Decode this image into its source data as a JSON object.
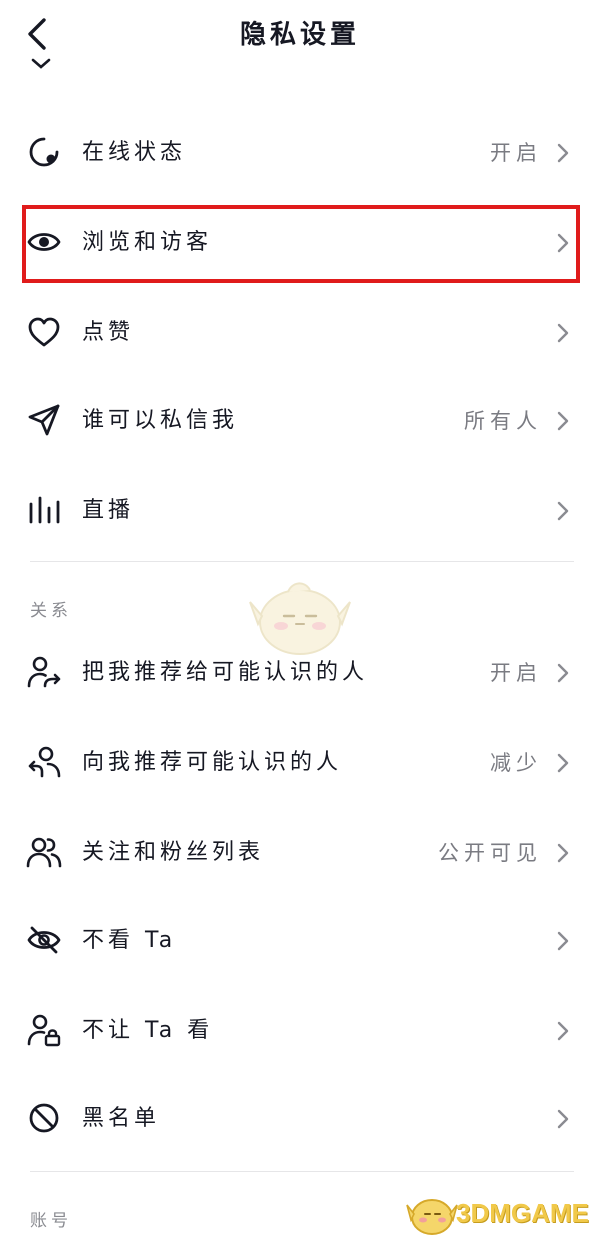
{
  "header": {
    "title": "隐私设置",
    "back_icon": "chevron-left-icon"
  },
  "rows": [
    {
      "icon": "online-status-icon",
      "label": "在线状态",
      "value": "开启"
    },
    {
      "icon": "eye-icon",
      "label": "浏览和访客",
      "value": ""
    },
    {
      "icon": "heart-icon",
      "label": "点赞",
      "value": ""
    },
    {
      "icon": "paper-plane-icon",
      "label": "谁可以私信我",
      "value": "所有人"
    },
    {
      "icon": "live-bars-icon",
      "label": "直播",
      "value": ""
    }
  ],
  "relation": {
    "section_title": "关系",
    "rows": [
      {
        "icon": "user-share-icon",
        "label": "把我推荐给可能认识的人",
        "value": "开启"
      },
      {
        "icon": "user-recommend-icon",
        "label": "向我推荐可能认识的人",
        "value": "减少"
      },
      {
        "icon": "users-icon",
        "label": "关注和粉丝列表",
        "value": "公开可见"
      },
      {
        "icon": "eye-off-icon",
        "label": "不看 Ta",
        "value": ""
      },
      {
        "icon": "user-lock-icon",
        "label": "不让 Ta 看",
        "value": ""
      },
      {
        "icon": "block-icon",
        "label": "黑名单",
        "value": ""
      }
    ]
  },
  "account": {
    "section_title": "账号"
  },
  "watermark": {
    "text": "3DMGAME"
  },
  "colors": {
    "highlight": "#e01b1b",
    "text": "#161823",
    "secondary": "#7a7b82",
    "watermark": "#f1c94a"
  }
}
